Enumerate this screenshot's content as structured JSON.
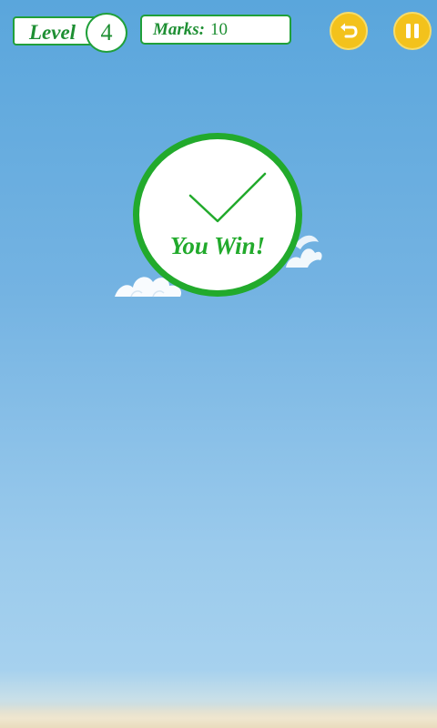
{
  "hud": {
    "level_label": "Level",
    "level_value": "4",
    "marks_label": "Marks:",
    "marks_value": "10",
    "restart_icon": "restart-arrow-icon",
    "pause_icon": "pause-icon"
  },
  "result": {
    "message": "You Win!",
    "icon": "checkmark-icon"
  },
  "colors": {
    "accent_green": "#22aa2c",
    "button_yellow": "#f3c21c",
    "sky_blue": "#5aa6dc"
  }
}
